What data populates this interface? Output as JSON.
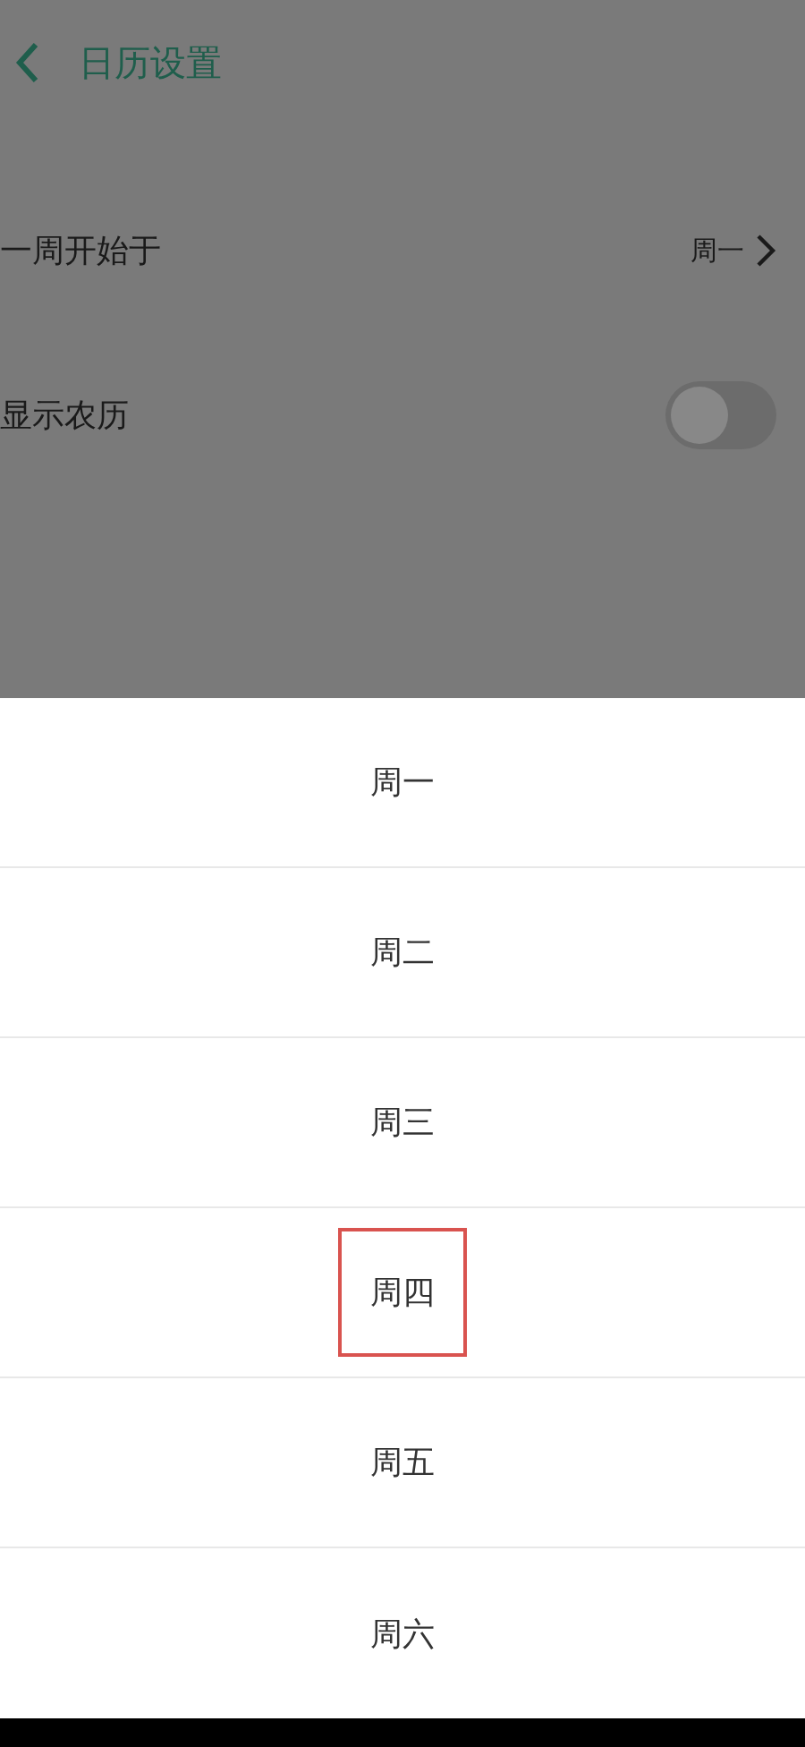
{
  "header": {
    "title": "日历设置"
  },
  "settings": [
    {
      "kind": "value",
      "label": "一周开始于",
      "value": "周一"
    },
    {
      "kind": "toggle",
      "label": "显示农历",
      "on": false
    }
  ],
  "picker": {
    "options": [
      {
        "label": "周一",
        "outlined": false
      },
      {
        "label": "周二",
        "outlined": false
      },
      {
        "label": "周三",
        "outlined": false
      },
      {
        "label": "周四",
        "outlined": true
      },
      {
        "label": "周五",
        "outlined": false
      },
      {
        "label": "周六",
        "outlined": false
      }
    ]
  }
}
